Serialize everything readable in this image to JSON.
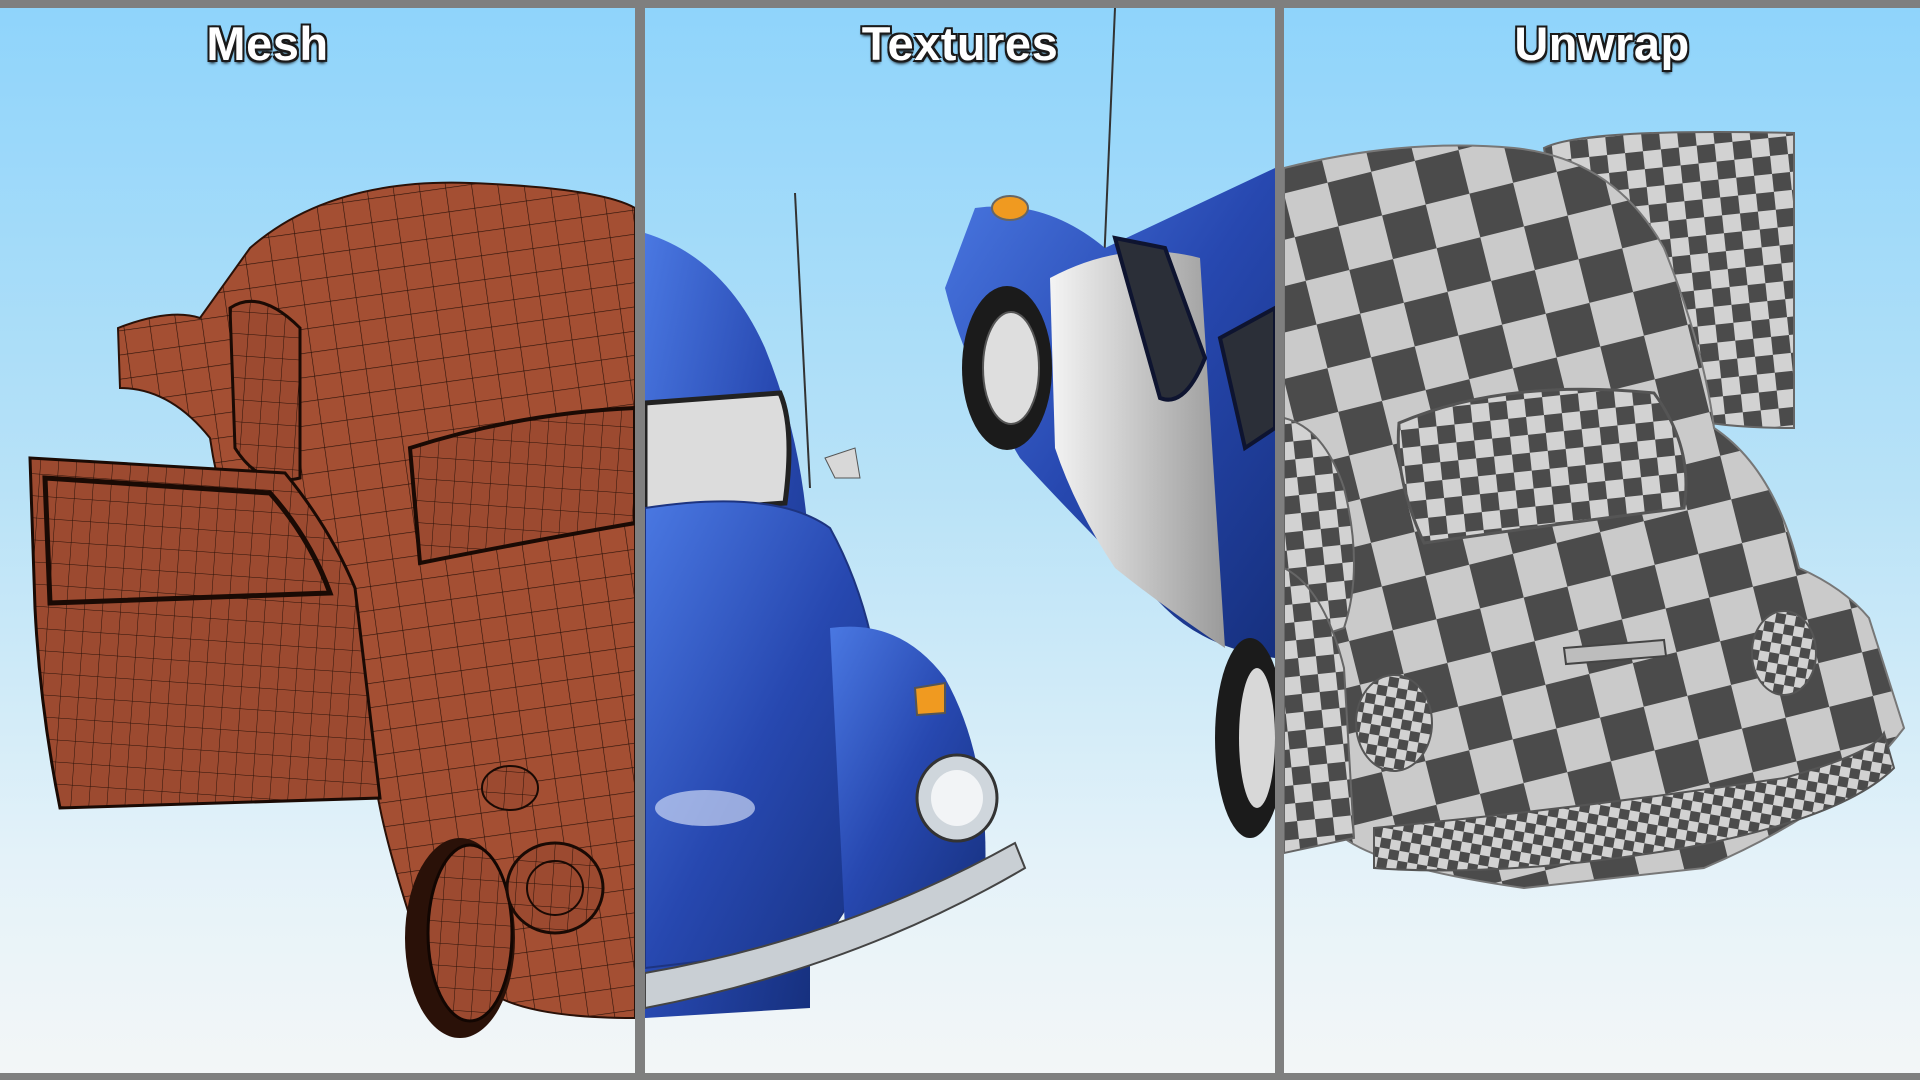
{
  "panels": [
    {
      "title": "Mesh"
    },
    {
      "title": "Textures"
    },
    {
      "title": "Unwrap"
    }
  ],
  "colors": {
    "divider": "#7f7f7f",
    "sky_top": "#8fd4fb",
    "sky_bottom": "#f3f6f7",
    "mesh_body": "#a44f33",
    "car_blue": "#2c55c4",
    "checker_dark": "#4a4a4a",
    "checker_light": "#c9c9c9"
  }
}
